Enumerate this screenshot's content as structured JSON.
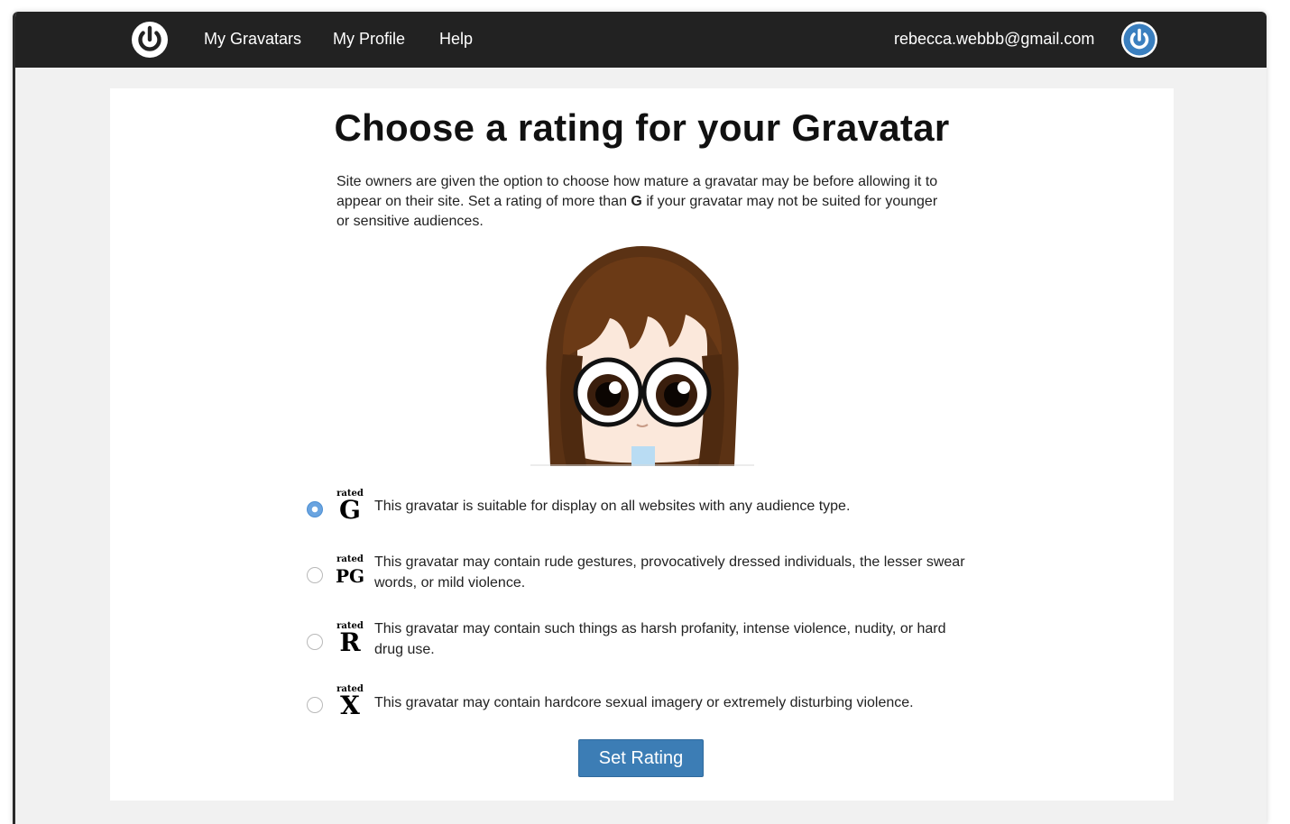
{
  "header": {
    "nav": [
      "My Gravatars",
      "My Profile",
      "Help"
    ],
    "user_email": "rebecca.webbb@gmail.com"
  },
  "page": {
    "title": "Choose a rating for your Gravatar",
    "intro_part1": "Site owners are given the option to choose how mature a gravatar may be before allowing it to appear on their site. Set a rating of more than ",
    "intro_bold": "G",
    "intro_part2": " if your gravatar may not be suited for younger or sensitive audiences."
  },
  "ratings": [
    {
      "small": "rated",
      "letter": "G",
      "description": "This gravatar is suitable for display on all websites with any audience type.",
      "selected": true
    },
    {
      "small": "rated",
      "letter": "PG",
      "description": "This gravatar may contain rude gestures, provocatively dressed individuals, the lesser swear words, or mild violence.",
      "selected": false
    },
    {
      "small": "rated",
      "letter": "R",
      "description": "This gravatar may contain such things as harsh profanity, intense violence, nudity, or hard drug use.",
      "selected": false
    },
    {
      "small": "rated",
      "letter": "X",
      "description": "This gravatar may contain hardcore sexual imagery or extremely disturbing violence.",
      "selected": false
    }
  ],
  "button": {
    "label": "Set Rating"
  },
  "colors": {
    "topbar": "#222222",
    "button": "#3c7db5",
    "radio_selected": "#6aa4e0",
    "avatar_blue": "#3a7fbf"
  },
  "icons": {
    "logo": "gravatar-power-icon",
    "user": "gravatar-power-icon"
  }
}
